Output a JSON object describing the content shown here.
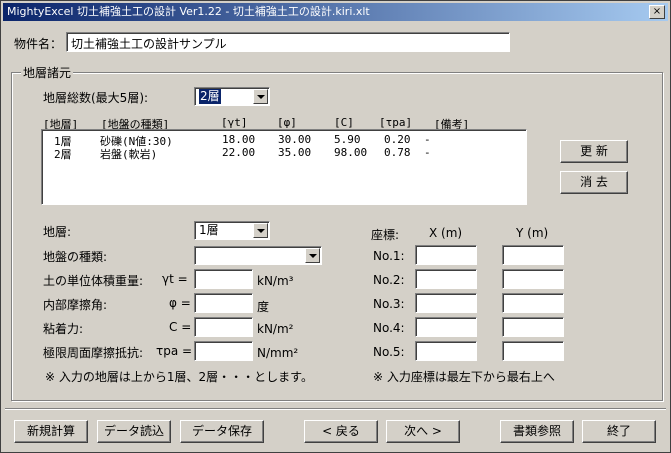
{
  "window": {
    "title": "MightyExcel 切土補強土工の設計 Ver1.22 - 切土補強土工の設計.kiri.xlt",
    "close": "×"
  },
  "project": {
    "label": "物件名：",
    "value": "切土補強土工の設計サンプル"
  },
  "strata_group": {
    "label": "地層諸元",
    "count_label": "地層総数(最大5層):",
    "count_value": "2層",
    "list_headers": [
      "[地層]",
      "[地盤の種類]",
      "[γt]",
      "[φ]",
      "[C]",
      "[τpa]",
      "[備考]"
    ],
    "rows": [
      [
        "1層",
        "砂礫(N値:30)",
        "18.00",
        "30.00",
        "5.90",
        "0.20",
        "-"
      ],
      [
        "2層",
        "岩盤(軟岩)",
        "22.00",
        "35.00",
        "98.00",
        "0.78",
        "-"
      ]
    ],
    "update_button": "更 新",
    "delete_button": "消 去",
    "layer_label": "地層:",
    "layer_value": "1層",
    "soil_type_label": "地盤の種類:",
    "soil_type_value": "",
    "unit_weight_label": "土の単位体積重量:",
    "unit_weight_symbol": "γt =",
    "unit_weight_unit": "kN/m³",
    "friction_label": "内部摩擦角:",
    "friction_symbol": "φ =",
    "friction_unit": "度",
    "cohesion_label": "粘着力:",
    "cohesion_symbol": "C =",
    "cohesion_unit": "kN/m²",
    "limit_label": "極限周面摩擦抵抗:",
    "limit_symbol": "τpa =",
    "limit_unit": "N/mm²",
    "note_left": "※ 入力の地層は上から1層、2層・・・とします。",
    "coord_label": "座標:",
    "x_header": "X (m)",
    "y_header": "Y (m)",
    "coord_rows": [
      "No.1:",
      "No.2:",
      "No.3:",
      "No.4:",
      "No.5:"
    ],
    "note_right": "※ 入力座標は最左下から最右上へ"
  },
  "footer": {
    "new": "新規計算",
    "load": "データ読込",
    "save": "データ保存",
    "back": "< 戻る",
    "next": "次へ >",
    "refs": "書類参照",
    "exit": "終了"
  }
}
